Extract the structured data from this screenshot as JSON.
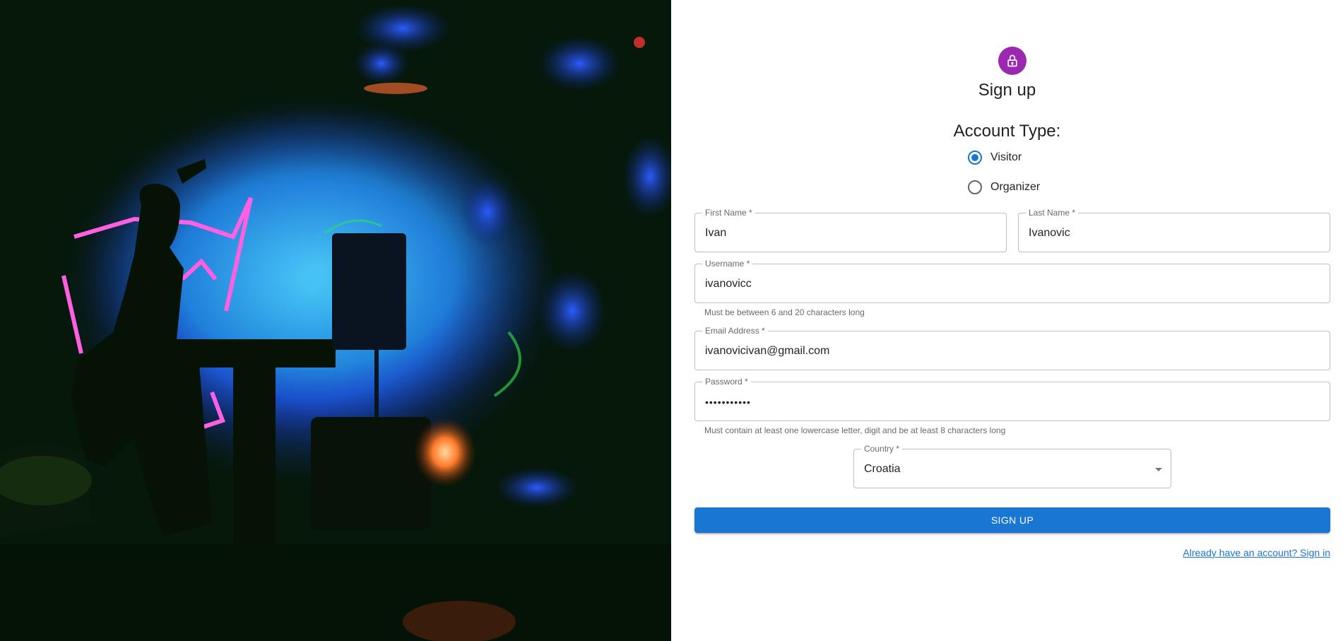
{
  "title": "Sign up",
  "account_type": {
    "label": "Account Type:",
    "options": [
      {
        "label": "Visitor",
        "selected": true
      },
      {
        "label": "Organizer",
        "selected": false
      }
    ]
  },
  "fields": {
    "first_name": {
      "label": "First Name *",
      "value": "Ivan"
    },
    "last_name": {
      "label": "Last Name *",
      "value": "Ivanovic"
    },
    "username": {
      "label": "Username *",
      "value": "ivanovicc",
      "helper": "Must be between 6 and 20 characters long"
    },
    "email": {
      "label": "Email Address *",
      "value": "ivanovicivan@gmail.com"
    },
    "password": {
      "label": "Password *",
      "value": "•••••••••••",
      "helper": "Must contain at least one lowercase letter, digit and be at least 8 characters long"
    },
    "country": {
      "label": "Country *",
      "value": "Croatia"
    }
  },
  "submit_label": "SIGN UP",
  "signin_link": "Already have an account? Sign in",
  "colors": {
    "primary": "#1976d2",
    "avatar": "#9c27b0"
  },
  "icons": {
    "avatar": "lock-icon",
    "country_select": "chevron-down-icon"
  }
}
